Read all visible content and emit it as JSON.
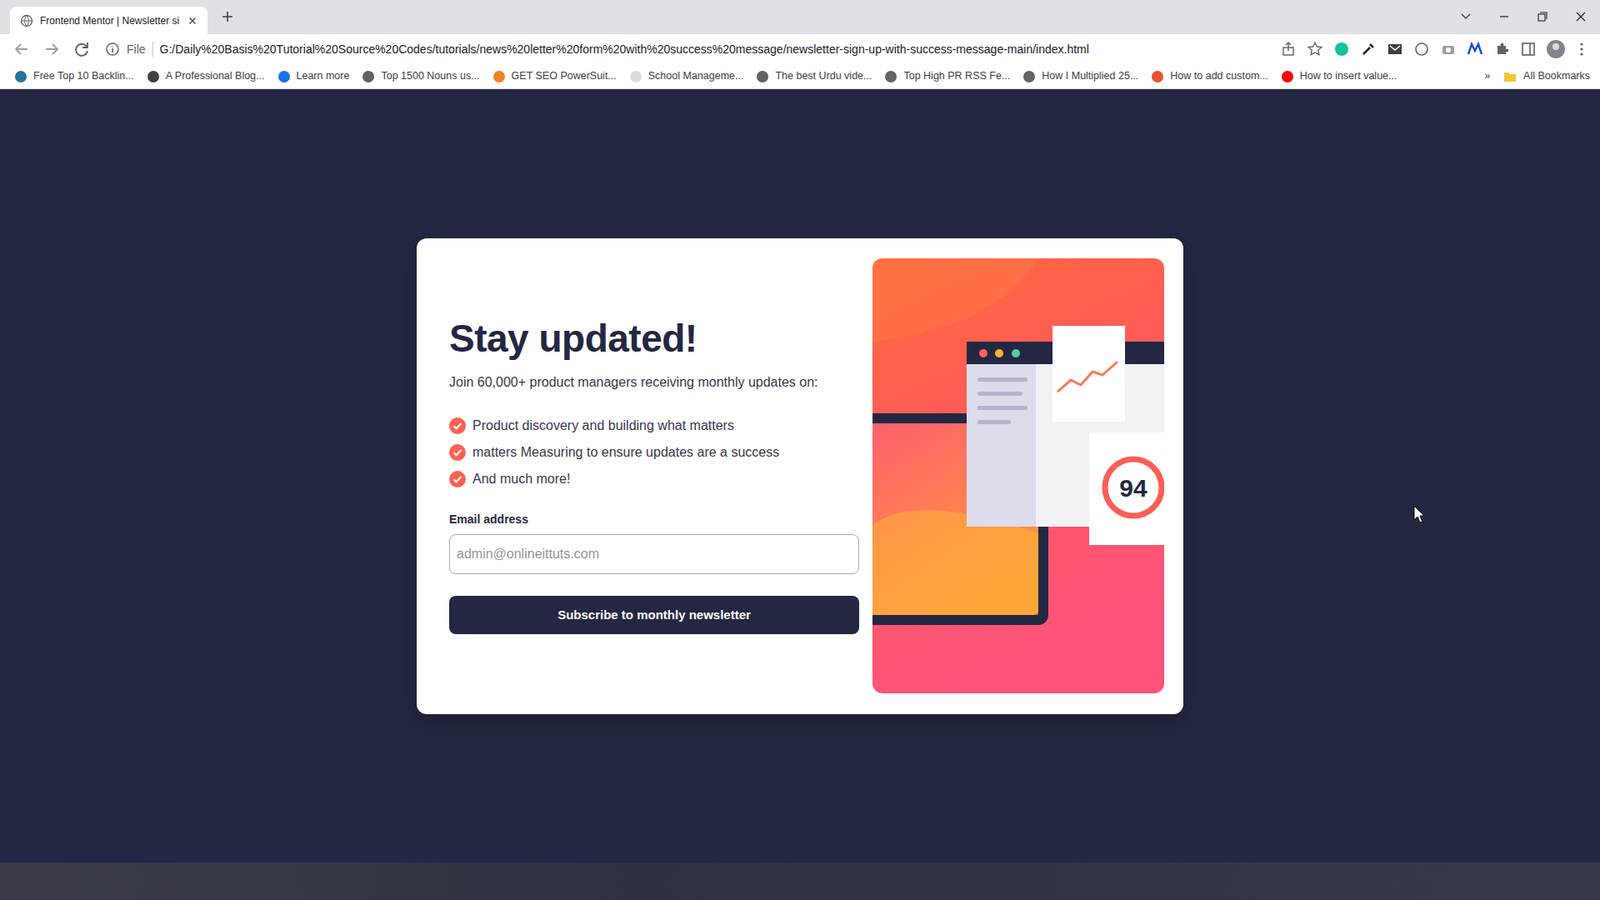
{
  "browser": {
    "tabs": [
      {
        "label": "Frontend Mentor | Newsletter si",
        "selected": true
      }
    ],
    "address": {
      "scheme": "File",
      "url": "G:/Daily%20Basis%20Tutorial%20Source%20Codes/tutorials/news%20letter%20form%20with%20success%20message/newsletter-sign-up-with-success-message-main/index.html"
    },
    "bookmarks": [
      {
        "label": "Free Top 10 Backlin...",
        "color": "#21759b"
      },
      {
        "label": "A Professional Blog...",
        "color": "#3c4043"
      },
      {
        "label": "Learn more",
        "color": "#1a73e8"
      },
      {
        "label": "Top 1500 Nouns us...",
        "color": "#5f6368"
      },
      {
        "label": "GET SEO PowerSuit...",
        "color": "#f48024"
      },
      {
        "label": "School Manageme...",
        "color": "#dadce0"
      },
      {
        "label": "The best Urdu vide...",
        "color": "#5f6368"
      },
      {
        "label": "Top High PR RSS Fe...",
        "color": "#5f6368"
      },
      {
        "label": "How I Multiplied 25...",
        "color": "#5f6368"
      },
      {
        "label": "How to add custom...",
        "color": "#e8542b"
      },
      {
        "label": "How to insert value...",
        "color": "#ff0000"
      }
    ],
    "overflow": "»",
    "all_bookmarks": "All Bookmarks"
  },
  "page": {
    "title": "Stay updated!",
    "intro": "Join 60,000+ product managers receiving monthly updates on:",
    "features": [
      "Product discovery and building what matters",
      "matters Measuring to ensure updates are a success",
      "And much more!"
    ],
    "email_label": "Email address",
    "email_placeholder": "admin@onlineittuts.com",
    "button": "Subscribe to monthly newsletter",
    "score": "94"
  }
}
